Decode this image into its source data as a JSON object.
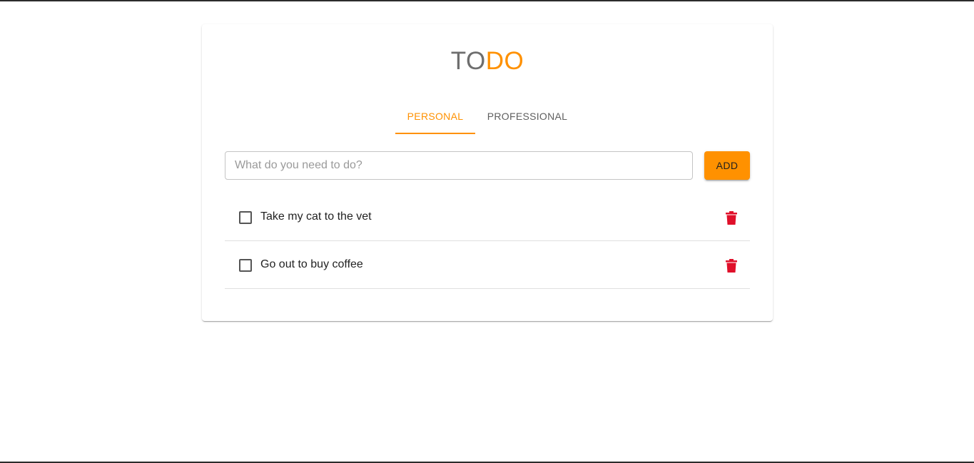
{
  "header": {
    "title_part1": "TO",
    "title_part2": "DO"
  },
  "tabs": [
    {
      "label": "PERSONAL",
      "active": true
    },
    {
      "label": "PROFESSIONAL",
      "active": false
    }
  ],
  "new_todo": {
    "placeholder": "What do you need to do?",
    "value": "",
    "add_label": "ADD"
  },
  "todos": [
    {
      "text": "Take my cat to the vet",
      "checked": false,
      "delete_icon": "trash-icon"
    },
    {
      "text": "Go out to buy coffee",
      "checked": false,
      "delete_icon": "trash-icon"
    }
  ],
  "colors": {
    "accent": "#ff9100",
    "delete": "#e0102a",
    "title_gray": "#6e6e6e"
  }
}
